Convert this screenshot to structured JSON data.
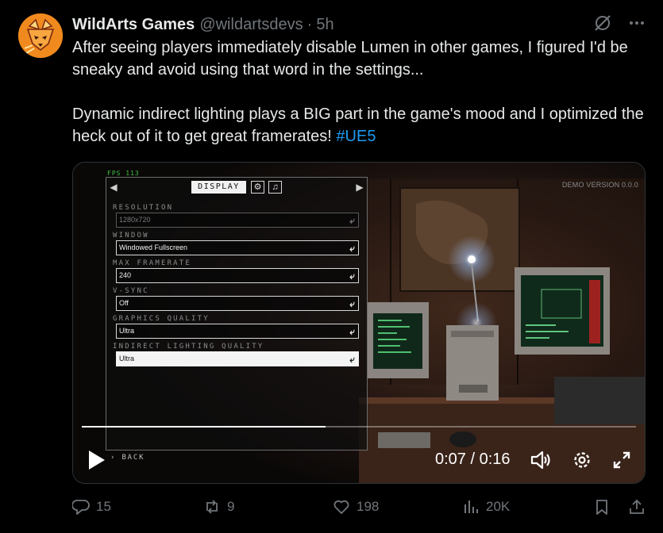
{
  "tweet": {
    "display_name": "WildArts Games",
    "handle": "@wildartsdevs",
    "separator": "·",
    "time": "5h",
    "paragraph1": "After seeing players immediately disable Lumen in other games, I figured I'd be sneaky and avoid using that word in the settings...",
    "paragraph2": "Dynamic indirect lighting plays a BIG part in the game's mood and I optimized the heck out of it to get great framerates!",
    "hashtag": "#UE5"
  },
  "video": {
    "fps_label": "FPS 113",
    "demo_version": "DEMO VERSION 0.0.0",
    "current_time": "0:07",
    "time_separator": "/",
    "duration": "0:16",
    "progress_fraction": 0.44,
    "menu": {
      "arrow_left": "◀",
      "arrow_right": "▶",
      "active_tab": "DISPLAY",
      "gear_tab_icon": "gear-icon",
      "music_tab_icon": "music-note-icon",
      "back_label": "BACK",
      "settings": [
        {
          "label": "RESOLUTION",
          "value": "1280x720",
          "state": "disabled"
        },
        {
          "label": "WINDOW",
          "value": "Windowed Fullscreen",
          "state": "normal"
        },
        {
          "label": "MAX FRAMERATE",
          "value": "240",
          "state": "normal"
        },
        {
          "label": "V-SYNC",
          "value": "Off",
          "state": "normal"
        },
        {
          "label": "GRAPHICS QUALITY",
          "value": "Ultra",
          "state": "normal"
        },
        {
          "label": "INDIRECT LIGHTING QUALITY",
          "value": "Ultra",
          "state": "selected"
        }
      ]
    }
  },
  "actions": {
    "replies": "15",
    "reposts": "9",
    "likes": "198",
    "views": "20K"
  },
  "colors": {
    "background": "#000000",
    "text": "#e7e9ea",
    "muted": "#71767b",
    "link": "#1d9bf0",
    "fps_green": "#3fc247",
    "avatar_orange": "#f08a1e"
  }
}
